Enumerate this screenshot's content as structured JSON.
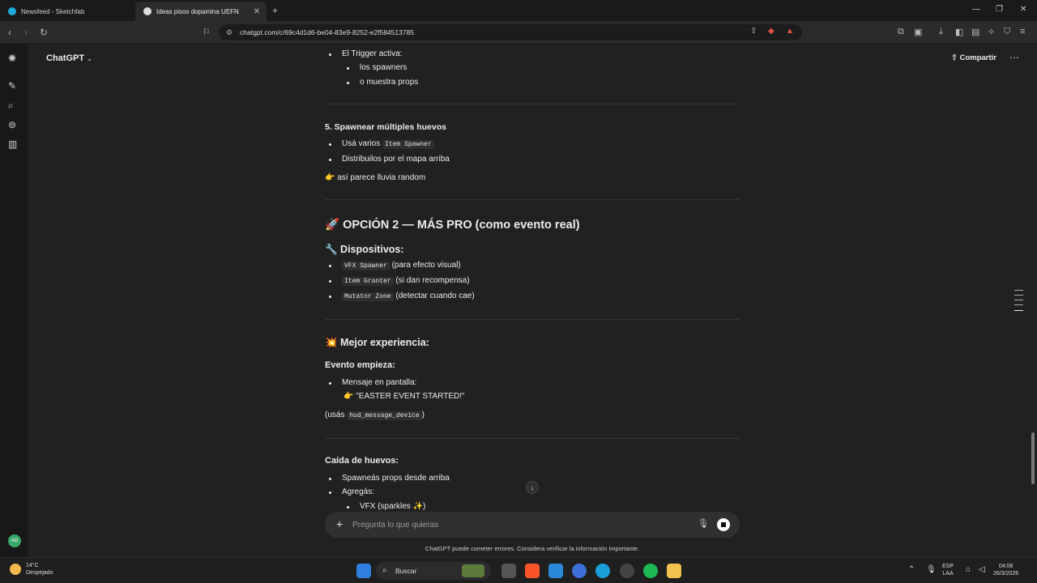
{
  "browser": {
    "tabs": [
      {
        "title": "Newsfeed - Sketchfab"
      },
      {
        "title": "Ideas pisos dopamina UEFN"
      }
    ],
    "url": "chatgpt.com/c/69c4d1d6-be04-83e9-8252-e2f584513785"
  },
  "app": {
    "name": "ChatGPT",
    "share_label": "Compartir"
  },
  "message": {
    "item4_trigger": "El Trigger activa:",
    "item4_sub1": "los spawners",
    "item4_sub2": "o muestra props",
    "h5": "5. Spawnear múltiples huevos",
    "h5_b1_pre": "Usá varios",
    "h5_b1_code": "Item Spawner",
    "h5_b2": "Distribuilos por el mapa arriba",
    "h5_note": "👉 así parece lluvia random",
    "opcion2": "🚀 OPCIÓN 2 — MÁS PRO (como evento real)",
    "dispositivos": "🔧 Dispositivos:",
    "dev1_code": "VFX Spawner",
    "dev1_text": "(para efecto visual)",
    "dev2_code": "Item Granter",
    "dev2_text": "(si dan recompensa)",
    "dev3_code": "Mutator Zone",
    "dev3_text": "(detectar cuando cae)",
    "mejor": "💥 Mejor experiencia:",
    "evento": "Evento empieza:",
    "ev_b1": "Mensaje en pantalla:",
    "ev_b1_sub": "👉 \"EASTER EVENT STARTED!\"",
    "usas_pre": "(usás",
    "usas_code": "hud_message_device",
    "usas_post": ")",
    "caida": "Caída de huevos:",
    "caida_b1": "Spawneás props desde arriba",
    "caida_b2": "Agregás:",
    "caida_sub1": "VFX (sparkles ✨)"
  },
  "composer": {
    "placeholder": "Pregunta lo que quieras"
  },
  "disclaimer": "ChatGPT puede cometer errores. Considera verificar la información importante.",
  "taskbar": {
    "temp": "14°C",
    "weather": "Despejado",
    "search": "Buscar",
    "lang1": "ESP",
    "lang2": "LAA",
    "time": "04:08",
    "date": "26/3/2026"
  }
}
